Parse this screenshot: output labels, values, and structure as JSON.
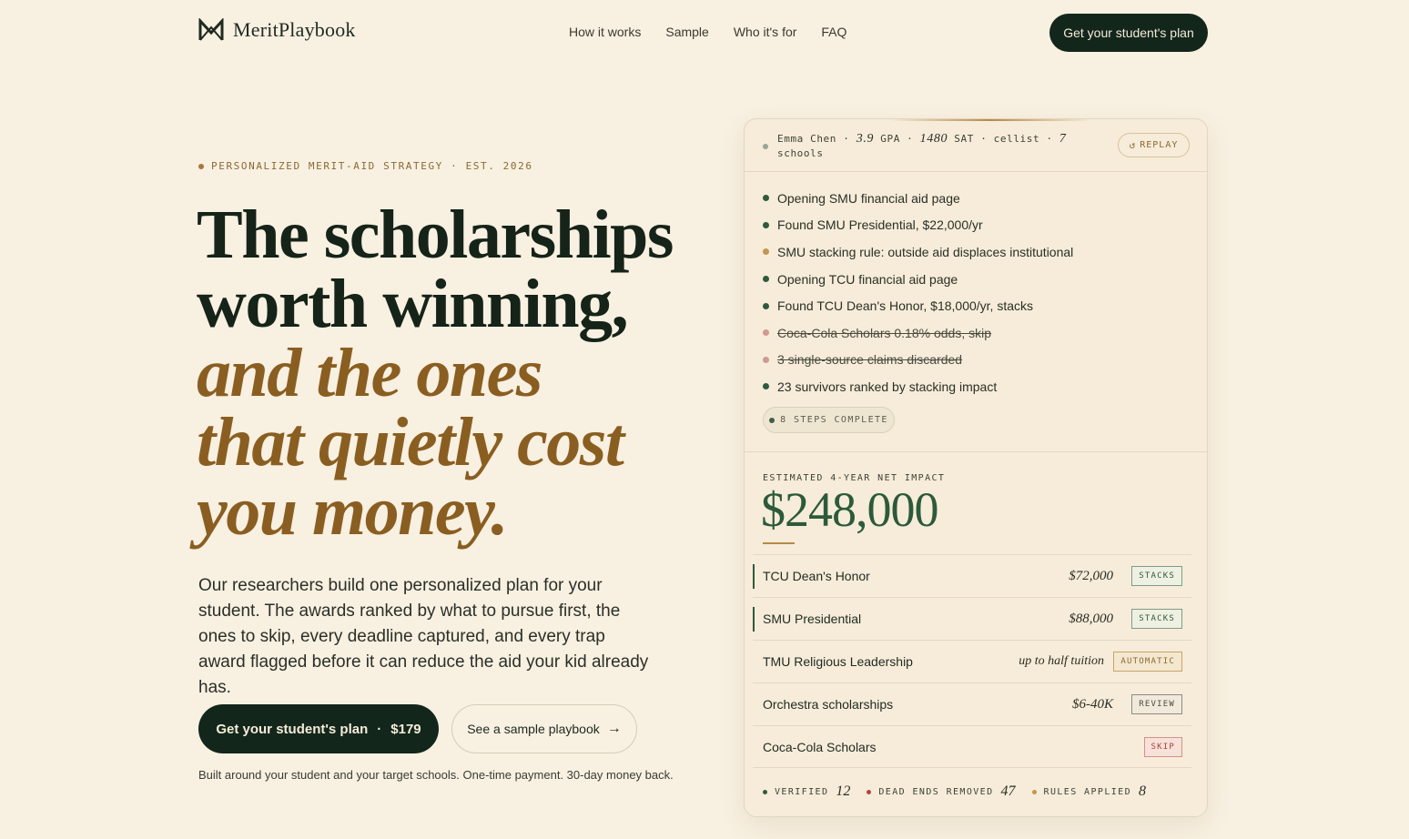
{
  "nav": {
    "brand": "MeritPlaybook",
    "links": [
      "How it works",
      "Sample",
      "Who it's for",
      "FAQ"
    ],
    "cta": "Get your student's plan"
  },
  "hero": {
    "eyebrow": "PERSONALIZED MERIT-AID STRATEGY · EST. 2026",
    "headline_line1": "The scholarships",
    "headline_line2": "worth winning,",
    "headline_italic1": "and the ones",
    "headline_italic2": "that quietly cost",
    "headline_italic3": "you money.",
    "subcopy": "Our researchers build one personalized plan for your student. The awards ranked by what to pursue first, the ones to skip, every deadline captured, and every trap award flagged before it can reduce the aid your kid already has.",
    "primary_cta_label": "Get your student's plan",
    "primary_cta_sep": "·",
    "primary_cta_price": "$179",
    "secondary_cta_label": "See a sample playbook",
    "secondary_cta_arrow": "→",
    "footnote": "Built around your student and your target schools. One-time payment. 30-day money back."
  },
  "card": {
    "profile": {
      "name": "Emma Chen",
      "gpa_value": "3.9",
      "gpa_label": "GPA",
      "sat_value": "1480",
      "sat_label": "SAT",
      "activity": "cellist",
      "schools_value": "7",
      "schools_label": "schools",
      "sep": "·"
    },
    "replay_label": "REPLAY",
    "steps": [
      {
        "text": "Opening SMU financial aid page",
        "status": "ok"
      },
      {
        "text": "Found SMU Presidential, $22,000/yr",
        "status": "ok"
      },
      {
        "text": "SMU stacking rule: outside aid displaces institutional",
        "status": "warn"
      },
      {
        "text": "Opening TCU financial aid page",
        "status": "ok"
      },
      {
        "text": "Found TCU Dean's Honor, $18,000/yr, stacks",
        "status": "ok"
      },
      {
        "text": "Coca-Cola Scholars 0.18% odds, skip",
        "status": "bad"
      },
      {
        "text": "3 single-source claims discarded",
        "status": "bad"
      },
      {
        "text": "23 survivors ranked by stacking impact",
        "status": "ok"
      }
    ],
    "steps_badge": "8 STEPS COMPLETE",
    "impact_label": "ESTIMATED 4-YEAR NET IMPACT",
    "impact_value": "$248,000",
    "awards": [
      {
        "name": "TCU Dean's Honor",
        "amount": "$72,000",
        "tag": "STACKS"
      },
      {
        "name": "SMU Presidential",
        "amount": "$88,000",
        "tag": "STACKS"
      },
      {
        "name": "TMU Religious Leadership",
        "amount": "up to half tuition",
        "tag": "AUTOMATIC"
      },
      {
        "name": "Orchestra scholarships",
        "amount": "$6-40K",
        "tag": "REVIEW"
      },
      {
        "name": "Coca-Cola Scholars",
        "amount": "",
        "tag": "SKIP"
      }
    ],
    "stats": {
      "verified_label": "VERIFIED",
      "verified_value": "12",
      "dead_ends_label": "DEAD ENDS REMOVED",
      "dead_ends_value": "47",
      "rules_label": "RULES APPLIED",
      "rules_value": "8"
    }
  },
  "colors": {
    "background": "#f8f0e1",
    "dark_green": "#13261b",
    "accent_gold": "#8a5e21",
    "impact_green": "#2c5a3a"
  }
}
